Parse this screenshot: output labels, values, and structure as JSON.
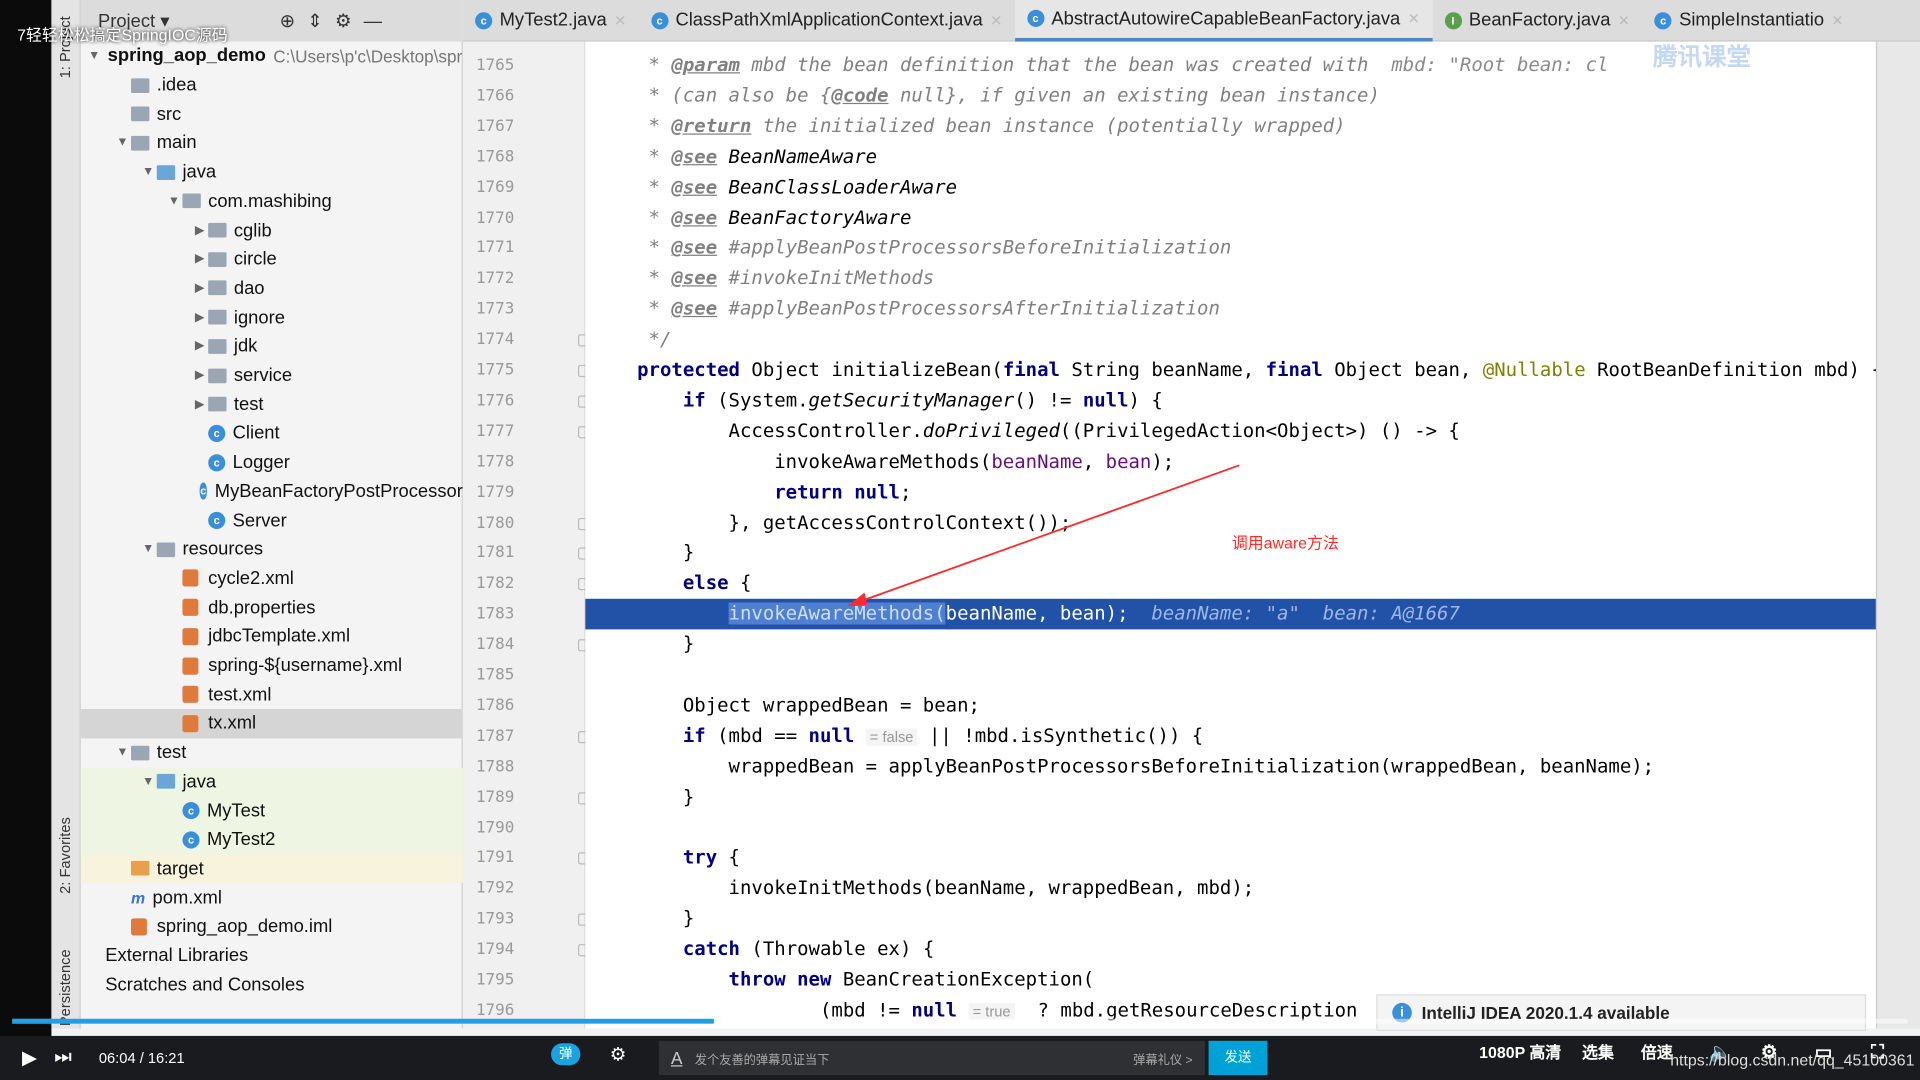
{
  "video_title": "7轻轻松松搞定SpringIOC源码",
  "watermark_logo": "腾讯课堂",
  "toolstrip": {
    "project": "1: Project",
    "favorites": "2: Favorites",
    "persistence": "Persistence"
  },
  "project_panel": {
    "title": "Project"
  },
  "tabs": [
    {
      "label": "MyTest2.java",
      "icon": "class-icon",
      "active": false
    },
    {
      "label": "ClassPathXmlApplicationContext.java",
      "icon": "class-icon",
      "active": false
    },
    {
      "label": "AbstractAutowireCapableBeanFactory.java",
      "icon": "class-icon",
      "active": true
    },
    {
      "label": "BeanFactory.java",
      "icon": "interface-icon",
      "active": false
    },
    {
      "label": "SimpleInstantiatio",
      "icon": "class-icon",
      "active": false
    }
  ],
  "tree": [
    {
      "label": "spring_aop_demo",
      "extra": "C:\\Users\\p'c\\Desktop\\spri",
      "level": 0,
      "type": "module",
      "arrow": "▼"
    },
    {
      "label": ".idea",
      "level": 1,
      "type": "folder",
      "arrow": ""
    },
    {
      "label": "src",
      "level": 1,
      "type": "folder",
      "arrow": ""
    },
    {
      "label": "main",
      "level": 1,
      "type": "folder",
      "arrow": "▼"
    },
    {
      "label": "java",
      "level": 2,
      "type": "folder-blue",
      "arrow": "▼"
    },
    {
      "label": "com.mashibing",
      "level": 3,
      "type": "folder",
      "arrow": "▼"
    },
    {
      "label": "cglib",
      "level": 4,
      "type": "folder",
      "arrow": "▶"
    },
    {
      "label": "circle",
      "level": 4,
      "type": "folder",
      "arrow": "▶"
    },
    {
      "label": "dao",
      "level": 4,
      "type": "folder",
      "arrow": "▶"
    },
    {
      "label": "ignore",
      "level": 4,
      "type": "folder",
      "arrow": "▶"
    },
    {
      "label": "jdk",
      "level": 4,
      "type": "folder",
      "arrow": "▶"
    },
    {
      "label": "service",
      "level": 4,
      "type": "folder",
      "arrow": "▶"
    },
    {
      "label": "test",
      "level": 4,
      "type": "folder",
      "arrow": "▶"
    },
    {
      "label": "Client",
      "level": 4,
      "type": "class",
      "arrow": ""
    },
    {
      "label": "Logger",
      "level": 4,
      "type": "class",
      "arrow": ""
    },
    {
      "label": "MyBeanFactoryPostProcessor",
      "level": 4,
      "type": "class",
      "arrow": ""
    },
    {
      "label": "Server",
      "level": 4,
      "type": "class",
      "arrow": ""
    },
    {
      "label": "resources",
      "level": 2,
      "type": "folder",
      "arrow": "▼"
    },
    {
      "label": "cycle2.xml",
      "level": 3,
      "type": "xml",
      "arrow": ""
    },
    {
      "label": "db.properties",
      "level": 3,
      "type": "xml",
      "arrow": ""
    },
    {
      "label": "jdbcTemplate.xml",
      "level": 3,
      "type": "xml",
      "arrow": ""
    },
    {
      "label": "spring-${username}.xml",
      "level": 3,
      "type": "xml",
      "arrow": ""
    },
    {
      "label": "test.xml",
      "level": 3,
      "type": "xml",
      "arrow": ""
    },
    {
      "label": "tx.xml",
      "level": 3,
      "type": "xml",
      "arrow": "",
      "selected": true
    },
    {
      "label": "test",
      "level": 1,
      "type": "folder",
      "arrow": "▼"
    },
    {
      "label": "java",
      "level": 2,
      "type": "folder-green",
      "arrow": "▼",
      "bg": "green"
    },
    {
      "label": "MyTest",
      "level": 3,
      "type": "class",
      "arrow": "",
      "bg": "green"
    },
    {
      "label": "MyTest2",
      "level": 3,
      "type": "class",
      "arrow": "",
      "bg": "green"
    },
    {
      "label": "target",
      "level": 1,
      "type": "folder-orange",
      "arrow": "",
      "bg": "yellow"
    },
    {
      "label": "pom.xml",
      "level": 1,
      "type": "maven",
      "arrow": ""
    },
    {
      "label": "spring_aop_demo.iml",
      "level": 1,
      "type": "xml",
      "arrow": ""
    },
    {
      "label": "External Libraries",
      "level": 0,
      "type": "none",
      "arrow": ""
    },
    {
      "label": "Scratches and Consoles",
      "level": 0,
      "type": "none",
      "arrow": ""
    }
  ],
  "code": [
    {
      "n": "1765",
      "s": [
        [
          "cm",
          "     * "
        ],
        [
          "tag",
          "@param"
        ],
        [
          "cm",
          " mbd the bean definition that the bean was created with  "
        ],
        [
          "hint",
          "mbd: \"Root bean: cl"
        ]
      ]
    },
    {
      "n": "1766",
      "s": [
        [
          "cm",
          "     * (can also be {"
        ],
        [
          "tag",
          "@code"
        ],
        [
          "cm",
          " null}, if given an existing bean instance)"
        ]
      ]
    },
    {
      "n": "1767",
      "s": [
        [
          "cm",
          "     * "
        ],
        [
          "tag",
          "@return"
        ],
        [
          "cm",
          " the initialized bean instance (potentially wrapped)"
        ]
      ]
    },
    {
      "n": "1768",
      "s": [
        [
          "cm",
          "     * "
        ],
        [
          "tag",
          "@see"
        ],
        [
          "fn",
          " BeanNameAware"
        ]
      ]
    },
    {
      "n": "1769",
      "s": [
        [
          "cm",
          "     * "
        ],
        [
          "tag",
          "@see"
        ],
        [
          "fn",
          " BeanClassLoaderAware"
        ]
      ]
    },
    {
      "n": "1770",
      "s": [
        [
          "cm",
          "     * "
        ],
        [
          "tag",
          "@see"
        ],
        [
          "fn",
          " BeanFactoryAware"
        ]
      ]
    },
    {
      "n": "1771",
      "s": [
        [
          "cm",
          "     * "
        ],
        [
          "tag",
          "@see"
        ],
        [
          "cm",
          " #applyBeanPostProcessorsBeforeInitialization"
        ]
      ]
    },
    {
      "n": "1772",
      "s": [
        [
          "cm",
          "     * "
        ],
        [
          "tag",
          "@see"
        ],
        [
          "cm",
          " #invokeInitMethods"
        ]
      ]
    },
    {
      "n": "1773",
      "s": [
        [
          "cm",
          "     * "
        ],
        [
          "tag",
          "@see"
        ],
        [
          "cm",
          " #applyBeanPostProcessorsAfterInitialization"
        ]
      ]
    },
    {
      "n": "1774",
      "s": [
        [
          "cm",
          "     */"
        ]
      ]
    },
    {
      "n": "1775",
      "s": [
        [
          "kw",
          "    protected "
        ],
        [
          "",
          "Object initializeBean("
        ],
        [
          "kw",
          "final "
        ],
        [
          "",
          "String "
        ],
        [
          "",
          "beanName, "
        ],
        [
          "kw",
          "final "
        ],
        [
          "",
          "Object bean, "
        ],
        [
          "an",
          "@Nullable"
        ],
        [
          "",
          " RootBeanDefinition mbd) {"
        ]
      ]
    },
    {
      "n": "1776",
      "s": [
        [
          "kw",
          "        if "
        ],
        [
          "",
          "(System."
        ],
        [
          "fn",
          "getSecurityManager"
        ],
        [
          "",
          "() != "
        ],
        [
          "kw",
          "null"
        ],
        [
          "",
          ") {"
        ]
      ]
    },
    {
      "n": "1777",
      "s": [
        [
          "",
          "            AccessController."
        ],
        [
          "fn",
          "doPrivileged"
        ],
        [
          "",
          "((PrivilegedAction<Object>) () -> {"
        ]
      ]
    },
    {
      "n": "1778",
      "s": [
        [
          "",
          "                invokeAwareMethods("
        ],
        [
          "fd",
          "beanName"
        ],
        [
          "",
          ", "
        ],
        [
          "fd",
          "bean"
        ],
        [
          "",
          ");"
        ]
      ]
    },
    {
      "n": "1779",
      "s": [
        [
          "kw",
          "                return null"
        ],
        [
          "",
          ";"
        ]
      ]
    },
    {
      "n": "1780",
      "s": [
        [
          "",
          "            }, getAccessControlContext());"
        ]
      ]
    },
    {
      "n": "1781",
      "s": [
        [
          "",
          "        }"
        ]
      ]
    },
    {
      "n": "1782",
      "s": [
        [
          "kw",
          "        else "
        ],
        [
          "",
          "{"
        ]
      ]
    },
    {
      "n": "1783",
      "hl": true,
      "s": [
        [
          "",
          "            "
        ],
        [
          "sel",
          "invokeAwareMethods("
        ],
        [
          "",
          "beanName, bean);  "
        ],
        [
          "hint",
          "beanName: \"a\"  bean: A@1667"
        ]
      ]
    },
    {
      "n": "1784",
      "s": [
        [
          "",
          "        }"
        ]
      ]
    },
    {
      "n": "1785",
      "s": []
    },
    {
      "n": "1786",
      "s": [
        [
          "",
          "        Object wrappedBean = bean;"
        ]
      ]
    },
    {
      "n": "1787",
      "s": [
        [
          "kw",
          "        if "
        ],
        [
          "",
          "(mbd == "
        ],
        [
          "kw",
          "null "
        ],
        [
          "ihint",
          " = false "
        ],
        [
          "",
          " || !mbd.isSynthetic()) {"
        ]
      ]
    },
    {
      "n": "1788",
      "s": [
        [
          "",
          "            wrappedBean = applyBeanPostProcessorsBeforeInitialization(wrappedBean, beanName);"
        ]
      ]
    },
    {
      "n": "1789",
      "s": [
        [
          "",
          "        }"
        ]
      ]
    },
    {
      "n": "1790",
      "s": []
    },
    {
      "n": "1791",
      "s": [
        [
          "kw",
          "        try "
        ],
        [
          "",
          "{"
        ]
      ]
    },
    {
      "n": "1792",
      "s": [
        [
          "",
          "            invokeInitMethods(beanName, wrappedBean, mbd);"
        ]
      ]
    },
    {
      "n": "1793",
      "s": [
        [
          "",
          "        }"
        ]
      ]
    },
    {
      "n": "1794",
      "s": [
        [
          "kw",
          "        catch "
        ],
        [
          "",
          "(Throwable ex) {"
        ]
      ]
    },
    {
      "n": "1795",
      "s": [
        [
          "kw",
          "            throw new "
        ],
        [
          "",
          "BeanCreationException("
        ]
      ]
    },
    {
      "n": "1796",
      "s": [
        [
          "",
          "                    (mbd != "
        ],
        [
          "kw",
          "null "
        ],
        [
          "ihint",
          " = true "
        ],
        [
          "",
          "  ? mbd.getResourceDescription"
        ]
      ]
    }
  ],
  "annotation": "调用aware方法",
  "notification": "IntelliJ IDEA 2020.1.4 available",
  "player": {
    "current_time": "06:04",
    "total_time": "16:21",
    "progress_percent": 37,
    "danmu_placeholder": "发个友善的弹幕见证当下",
    "danmu_etiquette": "弹幕礼仪 >",
    "send": "发送",
    "quality": "1080P 高清",
    "episodes": "选集",
    "speed": "倍速",
    "watermark": "https://blog.csdn.net/qq_45100361"
  }
}
